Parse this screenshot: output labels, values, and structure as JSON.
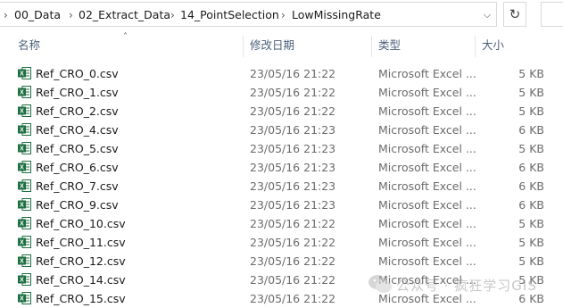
{
  "breadcrumb": [
    "00_Data",
    "02_Extract_Data",
    "14_PointSelection",
    "LowMissingRate"
  ],
  "columns": {
    "name": "名称",
    "modified": "修改日期",
    "type": "类型",
    "size": "大小"
  },
  "files": [
    {
      "name": "Ref_CRO_0.csv",
      "modified": "23/05/16 21:22",
      "type": "Microsoft Excel ...",
      "size": "5 KB"
    },
    {
      "name": "Ref_CRO_1.csv",
      "modified": "23/05/16 21:22",
      "type": "Microsoft Excel ...",
      "size": "5 KB"
    },
    {
      "name": "Ref_CRO_2.csv",
      "modified": "23/05/16 21:22",
      "type": "Microsoft Excel ...",
      "size": "5 KB"
    },
    {
      "name": "Ref_CRO_4.csv",
      "modified": "23/05/16 21:23",
      "type": "Microsoft Excel ...",
      "size": "6 KB"
    },
    {
      "name": "Ref_CRO_5.csv",
      "modified": "23/05/16 21:23",
      "type": "Microsoft Excel ...",
      "size": "5 KB"
    },
    {
      "name": "Ref_CRO_6.csv",
      "modified": "23/05/16 21:23",
      "type": "Microsoft Excel ...",
      "size": "6 KB"
    },
    {
      "name": "Ref_CRO_7.csv",
      "modified": "23/05/16 21:23",
      "type": "Microsoft Excel ...",
      "size": "6 KB"
    },
    {
      "name": "Ref_CRO_9.csv",
      "modified": "23/05/16 21:23",
      "type": "Microsoft Excel ...",
      "size": "6 KB"
    },
    {
      "name": "Ref_CRO_10.csv",
      "modified": "23/05/16 21:22",
      "type": "Microsoft Excel ...",
      "size": "5 KB"
    },
    {
      "name": "Ref_CRO_11.csv",
      "modified": "23/05/16 21:22",
      "type": "Microsoft Excel ...",
      "size": "5 KB"
    },
    {
      "name": "Ref_CRO_12.csv",
      "modified": "23/05/16 21:22",
      "type": "Microsoft Excel ...",
      "size": "5 KB"
    },
    {
      "name": "Ref_CRO_14.csv",
      "modified": "23/05/16 21:22",
      "type": "Microsoft Excel ...",
      "size": "5 KB"
    },
    {
      "name": "Ref_CRO_15.csv",
      "modified": "23/05/16 21:22",
      "type": "Microsoft Excel ...",
      "size": "6 KB"
    }
  ],
  "watermark": "公众号 · 疯狂学习GIS",
  "icons": {
    "file": "excel-csv-icon",
    "dropdown": "chevron-down-icon",
    "refresh": "refresh-icon",
    "separator": "chevron-right-icon",
    "sort": "sort-ascending-icon"
  },
  "colors": {
    "excel_green": "#1d6f42",
    "header_text": "#4c607a",
    "meta_text": "#6b6b6b"
  }
}
